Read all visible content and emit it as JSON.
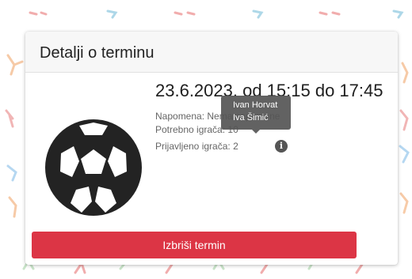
{
  "modal": {
    "title": "Detalji o terminu"
  },
  "event": {
    "date_time": "23.6.2023. od 15:15 do 17:45",
    "note_label": "Napomena:",
    "note_value": "Nema napomene",
    "needed_label": "Potrebno igrača:",
    "needed_value": "10",
    "registered_label": "Prijavljeno igrača:",
    "registered_value": "2"
  },
  "tooltip": {
    "players": [
      "Ivan Horvat",
      "Iva Šimić"
    ]
  },
  "actions": {
    "delete_label": "Izbriši termin"
  },
  "icons": {
    "sport": "soccer-ball-icon",
    "info": "info-icon"
  },
  "colors": {
    "danger": "#dc3545",
    "tooltip_bg": "#555555",
    "header_bg": "#f7f7f7"
  }
}
